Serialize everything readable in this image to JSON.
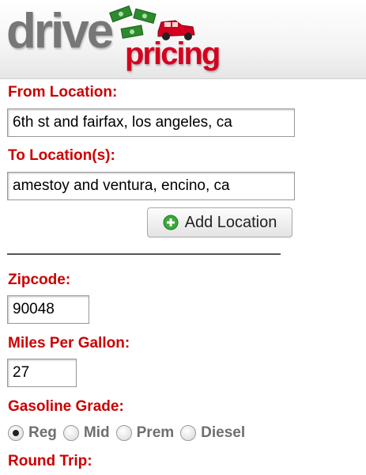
{
  "logo": {
    "word1": "drive",
    "word2": "pricing"
  },
  "form": {
    "from_label": "From Location:",
    "from_value": "6th st and fairfax, los angeles, ca",
    "to_label": "To Location(s):",
    "to_value": "amestoy and ventura, encino, ca",
    "add_location_label": "Add Location",
    "zip_label": "Zipcode:",
    "zip_value": "90048",
    "mpg_label": "Miles Per Gallon:",
    "mpg_value": "27",
    "grade_label": "Gasoline Grade:",
    "grades": [
      "Reg",
      "Mid",
      "Prem",
      "Diesel"
    ],
    "selected_grade": "Reg",
    "round_trip_label": "Round Trip:"
  },
  "colors": {
    "accent": "#cc0000",
    "logo_gray": "#777777",
    "logo_red": "#d4001f"
  }
}
